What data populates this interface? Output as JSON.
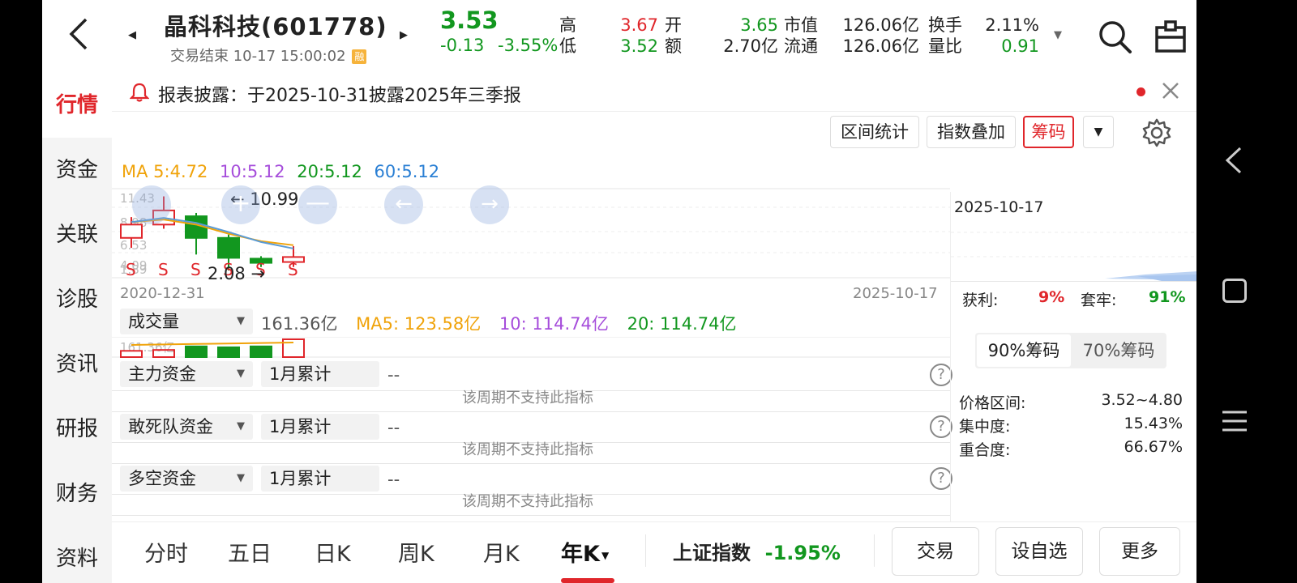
{
  "header": {
    "stock_name": "晶科科技(601778)",
    "status": "交易结束 10-17 15:00:02",
    "badge": "融",
    "price": "3.53",
    "change": "-0.13",
    "change_pct": "-3.55%",
    "quotes": [
      {
        "label": "高",
        "value": "3.67",
        "color": "red"
      },
      {
        "label": "低",
        "value": "3.52",
        "color": "green"
      },
      {
        "label": "开",
        "value": "3.65",
        "color": "green"
      },
      {
        "label": "额",
        "value": "2.70亿",
        "color": "dark"
      },
      {
        "label": "市值",
        "value": "126.06亿",
        "color": "dark"
      },
      {
        "label": "流通",
        "value": "126.06亿",
        "color": "dark"
      },
      {
        "label": "换手",
        "value": "2.11%",
        "color": "dark"
      },
      {
        "label": "量比",
        "value": "0.91",
        "color": "green"
      }
    ]
  },
  "sidebar": {
    "items": [
      {
        "label": "行情",
        "active": true
      },
      {
        "label": "资金"
      },
      {
        "label": "关联"
      },
      {
        "label": "诊股"
      },
      {
        "label": "资讯"
      },
      {
        "label": "研报"
      },
      {
        "label": "财务"
      },
      {
        "label": "资料"
      }
    ]
  },
  "notice": {
    "text": "报表披露：于2025-10-31披露2025年三季报"
  },
  "toolbar": {
    "range_stats": "区间统计",
    "index_overlay": "指数叠加",
    "chips": "筹码"
  },
  "ma": {
    "ma5": "MA 5:4.72",
    "ma10": "10:5.12",
    "ma20": "20:5.12",
    "ma60": "60:5.12"
  },
  "chart_data": {
    "type": "candlestick",
    "y_ticks": [
      "11.43",
      "8.98",
      "6.53",
      "4.09",
      "1.89"
    ],
    "max_label": "10.99",
    "min_label": "2.08",
    "start_date": "2020-12-31",
    "end_date": "2025-10-17",
    "candles": [
      {
        "open": 6.0,
        "close": 7.6,
        "high": 8.5,
        "low": 4.8,
        "up": true
      },
      {
        "open": 7.6,
        "close": 9.3,
        "high": 10.99,
        "low": 7.1,
        "up": true
      },
      {
        "open": 8.6,
        "close": 6.0,
        "high": 9.0,
        "low": 4.0,
        "up": false
      },
      {
        "open": 6.0,
        "close": 3.6,
        "high": 6.4,
        "low": 2.08,
        "up": false
      },
      {
        "open": 3.5,
        "close": 3.0,
        "high": 3.8,
        "low": 2.5,
        "up": false
      },
      {
        "open": 3.1,
        "close": 3.7,
        "high": 5.0,
        "low": 2.5,
        "up": true
      }
    ],
    "ma5_line": [
      7.9,
      8.4,
      7.8,
      6.7,
      5.5,
      4.72
    ],
    "ma10_line": [
      7.9,
      8.2,
      7.6,
      6.5,
      5.6,
      5.12
    ],
    "volume": {
      "label": "成交量",
      "value": "161.36亿",
      "ma5": "MA5: 123.58亿",
      "ma10": "10: 114.74亿",
      "ma20": "20: 114.74亿",
      "axis_label": "161.36亿",
      "bars": [
        {
          "v": 0.35,
          "up": true
        },
        {
          "v": 0.4,
          "up": true
        },
        {
          "v": 0.6,
          "up": false
        },
        {
          "v": 0.55,
          "up": false
        },
        {
          "v": 0.6,
          "up": false
        },
        {
          "v": 1.0,
          "up": true
        }
      ]
    }
  },
  "indicators": [
    {
      "name": "主力资金",
      "period": "1月累计",
      "value": "--",
      "note": "该周期不支持此指标"
    },
    {
      "name": "敢死队资金",
      "period": "1月累计",
      "value": "--",
      "note": "该周期不支持此指标"
    },
    {
      "name": "多空资金",
      "period": "1月累计",
      "value": "--",
      "note": "该周期不支持此指标"
    }
  ],
  "chip_panel": {
    "date": "2025-10-17",
    "profit_label": "获利:",
    "profit_value": "9%",
    "trapped_label": "套牢:",
    "trapped_value": "91%",
    "tab_90": "90%筹码",
    "tab_70": "70%筹码",
    "rows": [
      {
        "label": "价格区间:",
        "value": "3.52~4.80"
      },
      {
        "label": "集中度:",
        "value": "15.43%"
      },
      {
        "label": "重合度:",
        "value": "66.67%"
      }
    ]
  },
  "bottom": {
    "tabs": [
      "分时",
      "五日",
      "日K",
      "周K",
      "月K",
      "年K"
    ],
    "index_name": "上证指数",
    "index_change": "-1.95%",
    "trade": "交易",
    "add_watch": "设自选",
    "more": "更多"
  },
  "colors": {
    "up": "#e0262b",
    "down": "#12971f",
    "ma5": "#f0a30a",
    "ma10": "#a64ddb",
    "ma20": "#12971f",
    "ma60": "#2a7fd4"
  }
}
